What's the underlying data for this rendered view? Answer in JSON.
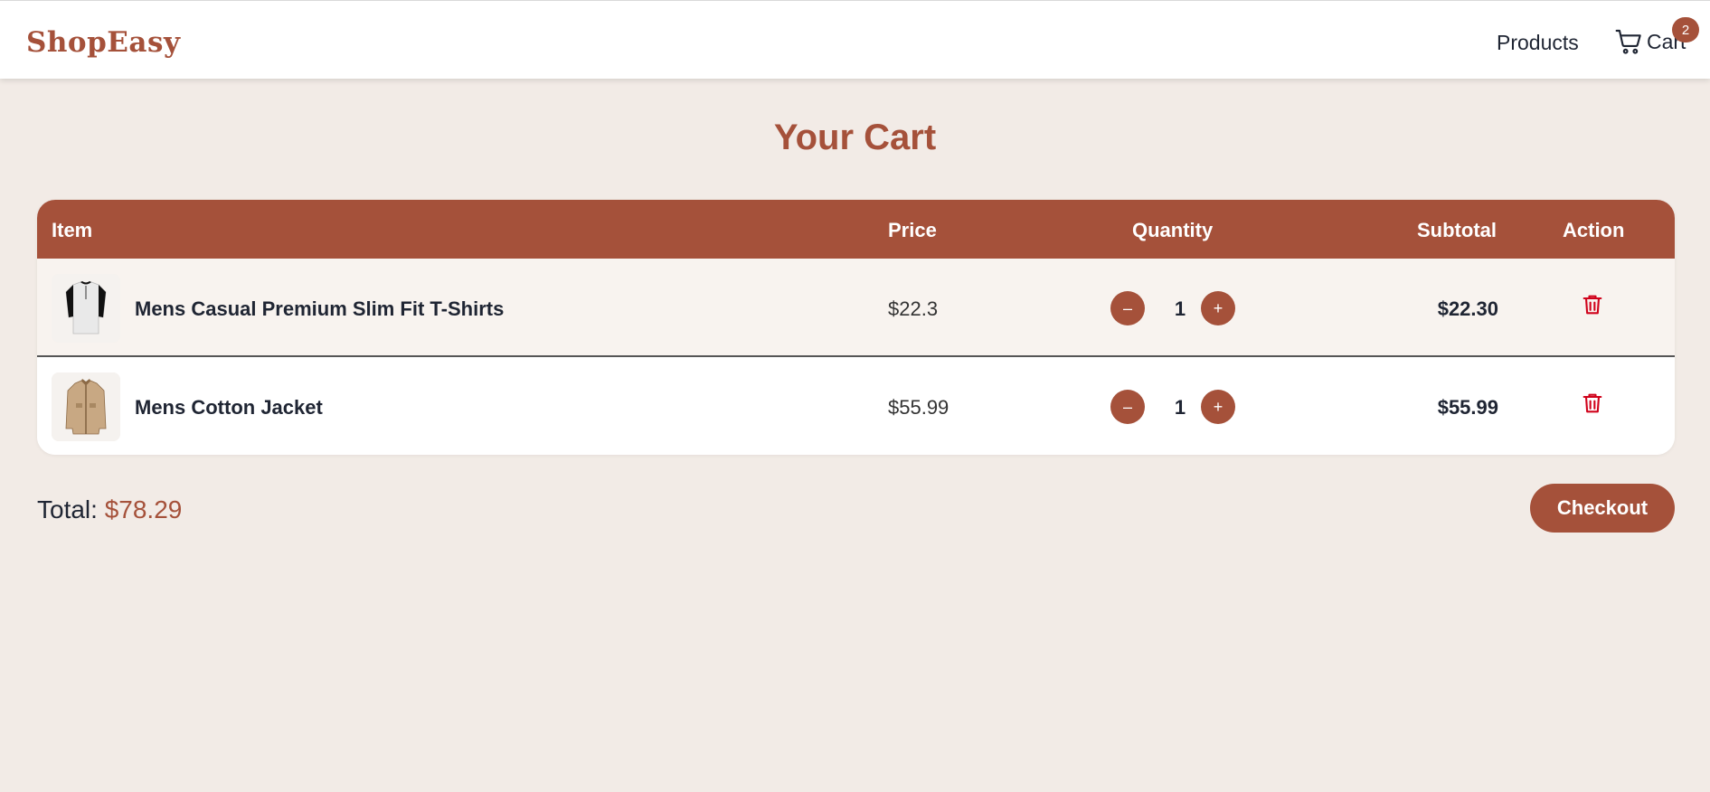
{
  "brand": "ShopEasy",
  "nav": {
    "products": "Products",
    "cart": "Cart",
    "cart_count": "2"
  },
  "page_title": "Your Cart",
  "table": {
    "headers": {
      "item": "Item",
      "price": "Price",
      "quantity": "Quantity",
      "subtotal": "Subtotal",
      "action": "Action"
    },
    "rows": [
      {
        "name": "Mens Casual Premium Slim Fit T-Shirts",
        "price": "$22.3",
        "quantity": "1",
        "subtotal": "$22.30",
        "minus": "–",
        "plus": "+"
      },
      {
        "name": "Mens Cotton Jacket",
        "price": "$55.99",
        "quantity": "1",
        "subtotal": "$55.99",
        "minus": "–",
        "plus": "+"
      }
    ]
  },
  "total": {
    "label": "Total:",
    "amount": "$78.29"
  },
  "checkout_label": "Checkout",
  "colors": {
    "accent": "#a5513a",
    "background": "#f2ebe6",
    "delete": "#d0021b"
  },
  "icons": [
    "cart-icon",
    "trash-icon",
    "tshirt-image",
    "jacket-image"
  ]
}
